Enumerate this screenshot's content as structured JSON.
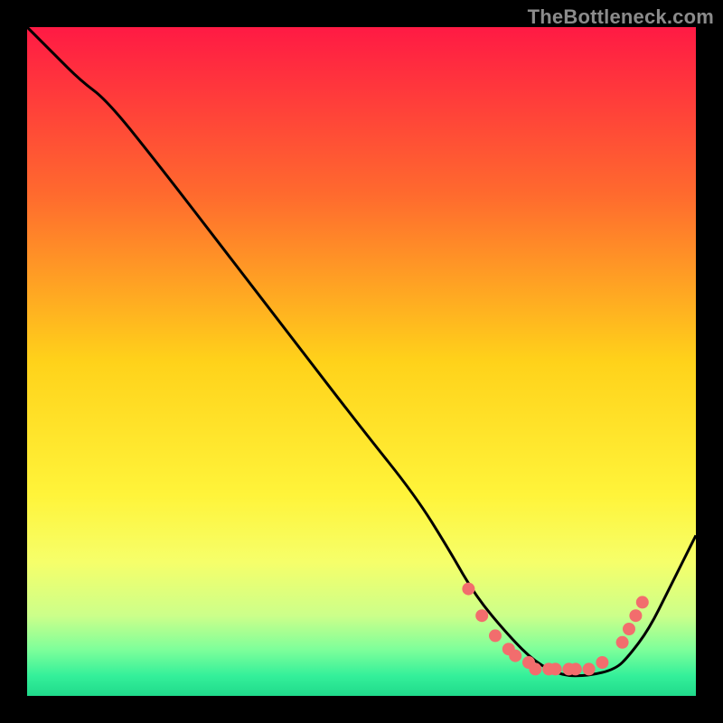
{
  "watermark": "TheBottleneck.com",
  "chart_data": {
    "type": "line",
    "title": "",
    "xlabel": "",
    "ylabel": "",
    "xlim": [
      0,
      100
    ],
    "ylim": [
      0,
      100
    ],
    "grid": false,
    "legend": false,
    "background_gradient_stops": [
      {
        "offset": 0.0,
        "color": "#ff1a44"
      },
      {
        "offset": 0.25,
        "color": "#ff6a2e"
      },
      {
        "offset": 0.5,
        "color": "#ffd21a"
      },
      {
        "offset": 0.7,
        "color": "#fff43a"
      },
      {
        "offset": 0.8,
        "color": "#f6ff6a"
      },
      {
        "offset": 0.88,
        "color": "#ccff8a"
      },
      {
        "offset": 0.93,
        "color": "#7fff9a"
      },
      {
        "offset": 0.97,
        "color": "#34f09a"
      },
      {
        "offset": 1.0,
        "color": "#20d98b"
      }
    ],
    "series": [
      {
        "name": "curve",
        "color": "#000000",
        "x": [
          0,
          4,
          8,
          12,
          20,
          30,
          40,
          50,
          58,
          63,
          67,
          72,
          76,
          80,
          84,
          88,
          90,
          93,
          96,
          100
        ],
        "y": [
          100,
          96,
          92,
          89,
          79,
          66,
          53,
          40,
          30,
          22,
          15,
          9,
          5,
          3,
          3,
          4,
          6,
          10,
          16,
          24
        ]
      }
    ],
    "markers": {
      "name": "highlight-dots",
      "color": "#f26d6d",
      "radius": 7,
      "points": [
        {
          "x": 66,
          "y": 16
        },
        {
          "x": 68,
          "y": 12
        },
        {
          "x": 70,
          "y": 9
        },
        {
          "x": 72,
          "y": 7
        },
        {
          "x": 73,
          "y": 6
        },
        {
          "x": 75,
          "y": 5
        },
        {
          "x": 76,
          "y": 4
        },
        {
          "x": 78,
          "y": 4
        },
        {
          "x": 79,
          "y": 4
        },
        {
          "x": 81,
          "y": 4
        },
        {
          "x": 82,
          "y": 4
        },
        {
          "x": 84,
          "y": 4
        },
        {
          "x": 86,
          "y": 5
        },
        {
          "x": 89,
          "y": 8
        },
        {
          "x": 90,
          "y": 10
        },
        {
          "x": 91,
          "y": 12
        },
        {
          "x": 92,
          "y": 14
        }
      ]
    }
  }
}
